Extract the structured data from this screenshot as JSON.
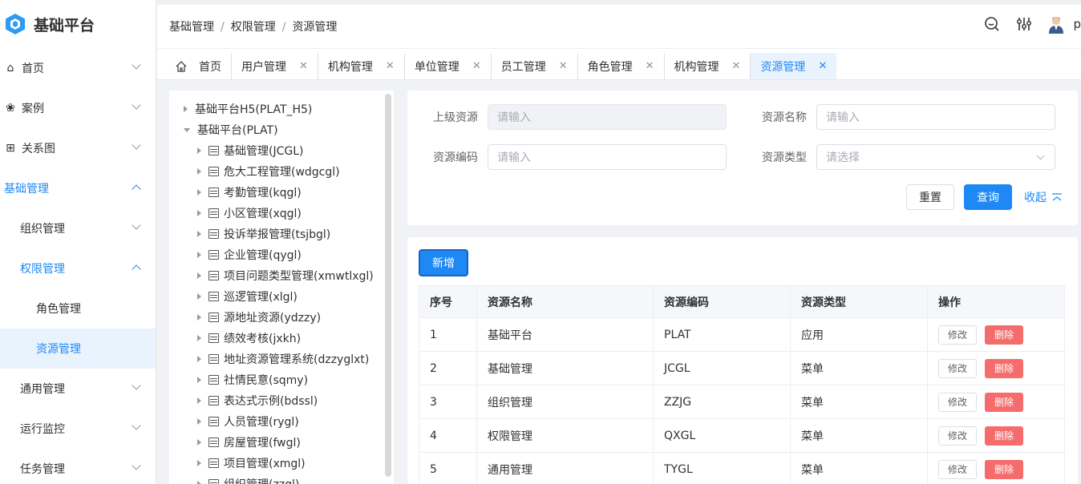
{
  "app": {
    "title": "基础平台"
  },
  "sidebar": {
    "items": [
      {
        "label": "首页",
        "icon": "home-icon"
      },
      {
        "label": "案例",
        "icon": "case-icon"
      },
      {
        "label": "关系图",
        "icon": "graph-icon"
      },
      {
        "label": "基础管理"
      },
      {
        "label": "组织管理"
      },
      {
        "label": "权限管理"
      },
      {
        "label": "角色管理"
      },
      {
        "label": "资源管理"
      },
      {
        "label": "通用管理"
      },
      {
        "label": "运行监控"
      },
      {
        "label": "任务管理"
      }
    ]
  },
  "breadcrumb": {
    "items": [
      "基础管理",
      "权限管理",
      "资源管理"
    ],
    "sep": "/"
  },
  "header": {
    "user_initial": "p"
  },
  "tabs": [
    {
      "label": "首页"
    },
    {
      "label": "用户管理",
      "close": "✕"
    },
    {
      "label": "机构管理",
      "close": "✕"
    },
    {
      "label": "单位管理",
      "close": "✕"
    },
    {
      "label": "员工管理",
      "close": "✕"
    },
    {
      "label": "角色管理",
      "close": "✕"
    },
    {
      "label": "机构管理",
      "close": "✕"
    },
    {
      "label": "资源管理",
      "close": "✕"
    }
  ],
  "tree": {
    "roots": [
      "基础平台H5(PLAT_H5)",
      "基础平台(PLAT)"
    ],
    "children": [
      "基础管理(JCGL)",
      "危大工程管理(wdgcgl)",
      "考勤管理(kqgl)",
      "小区管理(xqgl)",
      "投诉举报管理(tsjbgl)",
      "企业管理(qygl)",
      "项目问题类型管理(xmwtlxgl)",
      "巡逻管理(xlgl)",
      "源地址资源(ydzzy)",
      "绩效考核(jxkh)",
      "地址资源管理系统(dzzyglxt)",
      "社情民意(sqmy)",
      "表达式示例(bdssl)",
      "人员管理(rygl)",
      "房屋管理(fwgl)",
      "项目管理(xmgl)",
      "组织管理(zzgl)"
    ]
  },
  "search": {
    "parent_label": "上级资源",
    "parent_placeholder": "请输入",
    "name_label": "资源名称",
    "name_placeholder": "请输入",
    "code_label": "资源编码",
    "code_placeholder": "请输入",
    "type_label": "资源类型",
    "type_placeholder": "请选择",
    "reset": "重置",
    "query": "查询",
    "collapse": "收起"
  },
  "table": {
    "add_button": "新增",
    "columns": [
      "序号",
      "资源名称",
      "资源编码",
      "资源类型",
      "操作"
    ],
    "rows": [
      [
        "1",
        "基础平台",
        "PLAT",
        "应用"
      ],
      [
        "2",
        "基础管理",
        "JCGL",
        "菜单"
      ],
      [
        "3",
        "组织管理",
        "ZZJG",
        "菜单"
      ],
      [
        "4",
        "权限管理",
        "QXGL",
        "菜单"
      ],
      [
        "5",
        "通用管理",
        "TYGL",
        "菜单"
      ]
    ],
    "edit_label": "修改",
    "delete_label": "删除"
  },
  "colors": {
    "primary": "#1e88f5",
    "danger": "#f56c6c"
  }
}
